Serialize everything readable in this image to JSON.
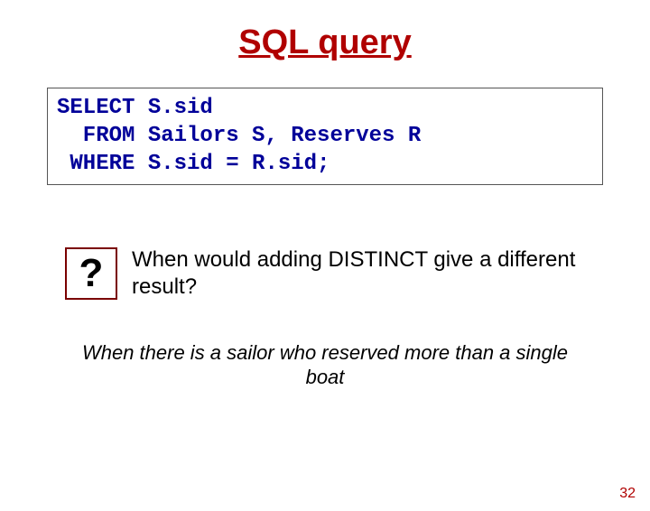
{
  "title": "SQL query",
  "code": {
    "line1": "SELECT S.sid",
    "line2": "  FROM Sailors S, Reserves R",
    "line3": " WHERE S.sid = R.sid;"
  },
  "question_mark": "?",
  "question_text": "When would adding DISTINCT give a different result?",
  "answer": "When there is a sailor who reserved more than a single boat",
  "page_number": "32"
}
